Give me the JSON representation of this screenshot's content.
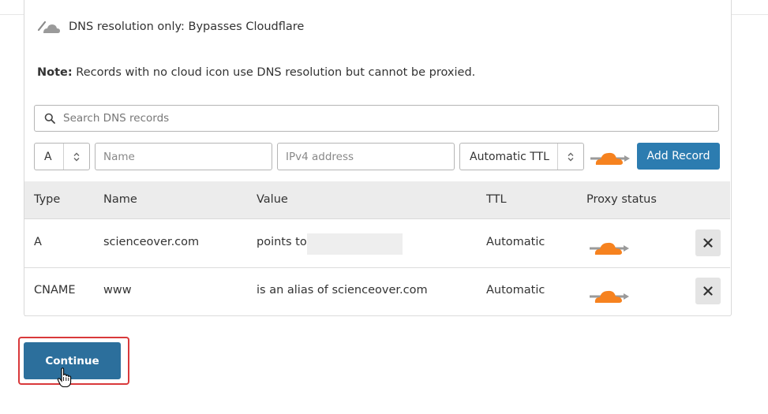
{
  "legend": {
    "dns_only_text": "DNS resolution only: Bypasses Cloudflare",
    "note_label": "Note:",
    "note_text": " Records with no cloud icon use DNS resolution but cannot be proxied."
  },
  "search": {
    "placeholder": "Search DNS records"
  },
  "add_form": {
    "type_value": "A",
    "name_placeholder": "Name",
    "value_placeholder": "IPv4 address",
    "ttl_value": "Automatic TTL",
    "add_label": "Add Record"
  },
  "table": {
    "headers": [
      "Type",
      "Name",
      "Value",
      "TTL",
      "Proxy status"
    ],
    "rows": [
      {
        "type": "A",
        "name": "scienceover.com",
        "value": "points to",
        "ttl": "Automatic"
      },
      {
        "type": "CNAME",
        "name": "www",
        "value": "is an alias of scienceover.com",
        "ttl": "Automatic"
      }
    ]
  },
  "footer": {
    "continue_label": "Continue"
  },
  "colors": {
    "accent": "#2c7cb0",
    "cloud_orange": "#f6821f",
    "highlight": "#d9393b"
  }
}
